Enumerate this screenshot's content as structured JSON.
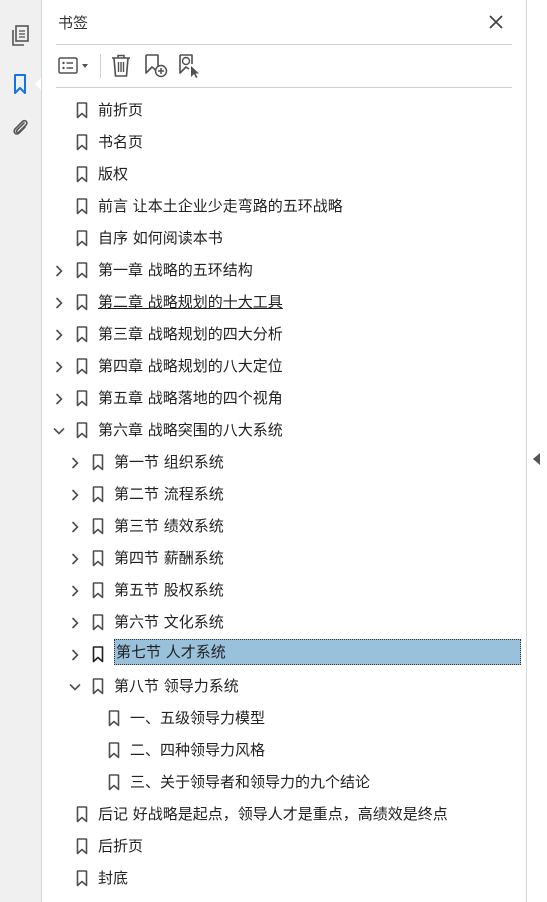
{
  "panel": {
    "title": "书签"
  },
  "rail": {
    "items": [
      {
        "icon": "pages-icon"
      },
      {
        "icon": "bookmark-icon",
        "active": true
      },
      {
        "icon": "attachment-icon"
      }
    ]
  },
  "toolbar": {
    "buttons": [
      {
        "icon": "options-menu-icon"
      },
      {
        "icon": "delete-icon"
      },
      {
        "icon": "new-bookmark-icon"
      },
      {
        "icon": "find-bookmark-icon"
      }
    ]
  },
  "bookmarks": [
    {
      "label": "前折页",
      "level": 0,
      "expander": "none"
    },
    {
      "label": "书名页",
      "level": 0,
      "expander": "none"
    },
    {
      "label": "版权",
      "level": 0,
      "expander": "none"
    },
    {
      "label": "前言 让本土企业少走弯路的五环战略",
      "level": 0,
      "expander": "none"
    },
    {
      "label": "自序 如何阅读本书",
      "level": 0,
      "expander": "none"
    },
    {
      "label": "第一章 战略的五环结构",
      "level": 0,
      "expander": "collapsed"
    },
    {
      "label": "第二章 战略规划的十大工具",
      "level": 0,
      "expander": "collapsed",
      "underline": true
    },
    {
      "label": "第三章 战略规划的四大分析",
      "level": 0,
      "expander": "collapsed"
    },
    {
      "label": "第四章 战略规划的八大定位",
      "level": 0,
      "expander": "collapsed"
    },
    {
      "label": "第五章 战略落地的四个视角",
      "level": 0,
      "expander": "collapsed"
    },
    {
      "label": "第六章 战略突围的八大系统",
      "level": 0,
      "expander": "expanded"
    },
    {
      "label": "第一节 组织系统",
      "level": 1,
      "expander": "collapsed"
    },
    {
      "label": "第二节 流程系统",
      "level": 1,
      "expander": "collapsed"
    },
    {
      "label": "第三节 绩效系统",
      "level": 1,
      "expander": "collapsed"
    },
    {
      "label": "第四节 薪酬系统",
      "level": 1,
      "expander": "collapsed"
    },
    {
      "label": "第五节 股权系统",
      "level": 1,
      "expander": "collapsed"
    },
    {
      "label": "第六节 文化系统",
      "level": 1,
      "expander": "collapsed"
    },
    {
      "label": "第七节 人才系统",
      "level": 1,
      "expander": "collapsed",
      "selected": true
    },
    {
      "label": "第八节 领导力系统",
      "level": 1,
      "expander": "expanded"
    },
    {
      "label": "一、五级领导力模型",
      "level": 2,
      "expander": "none"
    },
    {
      "label": "二、四种领导力风格",
      "level": 2,
      "expander": "none"
    },
    {
      "label": "三、关于领导者和领导力的九个结论",
      "level": 2,
      "expander": "none"
    },
    {
      "label": "后记 好战略是起点，领导人才是重点，高绩效是终点",
      "level": 0,
      "expander": "none"
    },
    {
      "label": "后折页",
      "level": 0,
      "expander": "none"
    },
    {
      "label": "封底",
      "level": 0,
      "expander": "none"
    }
  ],
  "colors": {
    "selection": "#9ac1dc",
    "accent": "#1473e6",
    "icon": "#505050"
  }
}
